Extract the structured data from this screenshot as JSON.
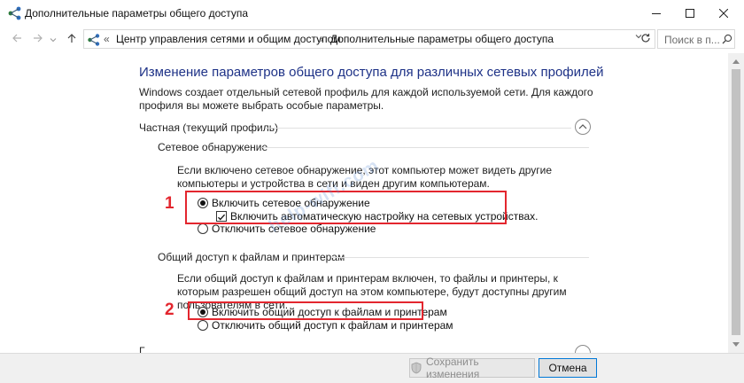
{
  "window": {
    "title": "Дополнительные параметры общего доступа",
    "minimize_icon": "minimize-icon",
    "maximize_icon": "maximize-icon",
    "close_icon": "close-icon"
  },
  "navigation": {
    "back_icon": "arrow-left-icon",
    "forward_icon": "arrow-right-icon",
    "recent_icon": "chevron-down-icon",
    "up_icon": "arrow-up-icon",
    "breadcrumb_overflow": "«",
    "breadcrumb": [
      "Центр управления сетями и общим доступом",
      "Дополнительные параметры общего доступа"
    ],
    "separator": "›",
    "search_placeholder": "Поиск в п..."
  },
  "main": {
    "heading": "Изменение параметров общего доступа для различных сетевых профилей",
    "description": "Windows создает отдельный сетевой профиль для каждой используемой сети. Для каждого профиля вы можете выбрать особые параметры.",
    "profile": {
      "title": "Частная (текущий профиль)",
      "expanded": true
    },
    "network_discovery": {
      "title": "Сетевое обнаружение",
      "description": "Если включено сетевое обнаружение, этот компьютер может видеть другие компьютеры и устройства в сети и виден другим компьютерам.",
      "option_on": "Включить сетевое обнаружение",
      "option_auto": "Включить автоматическую настройку на сетевых устройствах.",
      "option_off": "Отключить сетевое обнаружение",
      "selected": "on",
      "auto_checked": true
    },
    "file_sharing": {
      "title": "Общий доступ к файлам и принтерам",
      "description": "Если общий доступ к файлам и принтерам включен, то файлы и принтеры, к которым разрешен общий доступ на этом компьютере, будут доступны другим пользователям в сети.",
      "option_on": "Включить общий доступ к файлам и принтерам",
      "option_off": "Отключить общий доступ к файлам и принтерам",
      "selected": "on"
    },
    "next_profile_partial": "Г..."
  },
  "annotations": {
    "marker_1": "1",
    "marker_2": "2",
    "watermark": "help-wifi.com",
    "color": "#e3262e"
  },
  "footer": {
    "save_label": "Сохранить изменения",
    "save_enabled": false,
    "cancel_label": "Отмена"
  }
}
